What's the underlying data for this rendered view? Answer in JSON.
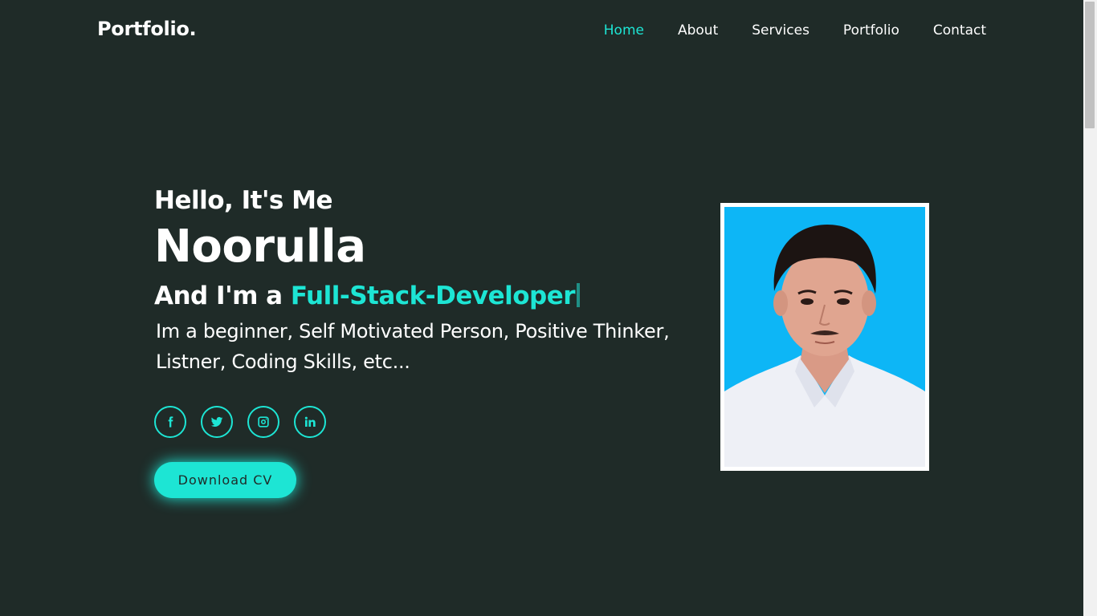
{
  "header": {
    "logo": "Portfolio.",
    "nav": [
      {
        "label": "Home",
        "active": true
      },
      {
        "label": "About",
        "active": false
      },
      {
        "label": "Services",
        "active": false
      },
      {
        "label": "Portfolio",
        "active": false
      },
      {
        "label": "Contact",
        "active": false
      }
    ]
  },
  "hero": {
    "greeting": "Hello, It's Me",
    "name": "Noorulla",
    "role_prefix": "And I'm a ",
    "role_highlight": "Full-Stack-Developer",
    "description": "Im a beginner, Self Motivated Person, Positive Thinker, Listner, Coding Skills, etc...",
    "socials": [
      {
        "icon": "facebook-icon"
      },
      {
        "icon": "twitter-icon"
      },
      {
        "icon": "instagram-icon"
      },
      {
        "icon": "linkedin-icon"
      }
    ],
    "download_label": "Download CV"
  },
  "colors": {
    "background": "#1f2b28",
    "accent": "#1de5d4",
    "text": "#ffffff",
    "photo_background": "#0db6f6"
  }
}
